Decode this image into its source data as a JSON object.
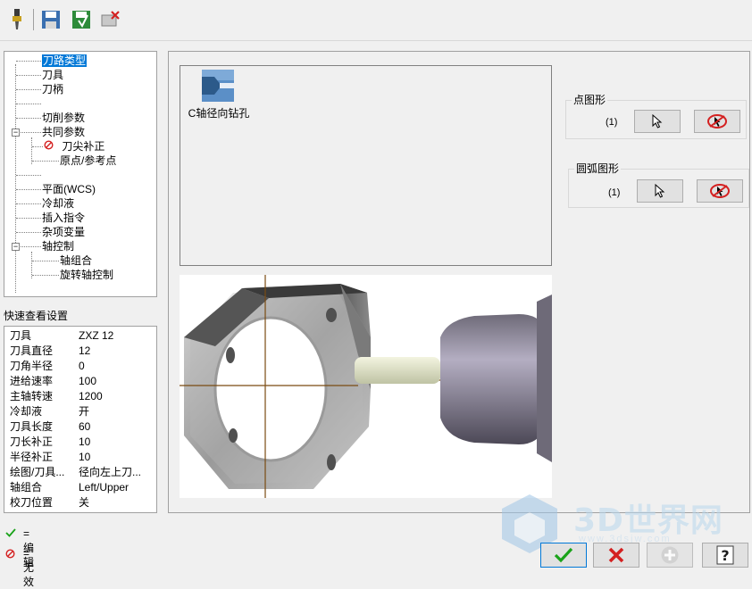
{
  "tree": {
    "items": [
      {
        "label": "刀路类型",
        "selected": true
      },
      {
        "label": "刀具"
      },
      {
        "label": "刀柄"
      },
      {
        "label": ""
      },
      {
        "label": "切削参数"
      },
      {
        "label": "共同参数"
      },
      {
        "label": "刀尖补正",
        "disabled": true
      },
      {
        "label": "原点/参考点"
      },
      {
        "label": ""
      },
      {
        "label": "平面(WCS)"
      },
      {
        "label": "冷却液"
      },
      {
        "label": "插入指令"
      },
      {
        "label": "杂项变量"
      },
      {
        "label": "轴控制"
      },
      {
        "label": "轴组合"
      },
      {
        "label": "旋转轴控制"
      }
    ]
  },
  "quick_view": {
    "title": "快速查看设置",
    "rows": [
      {
        "k": "刀具",
        "v": "ZXZ 12"
      },
      {
        "k": "刀具直径",
        "v": "12"
      },
      {
        "k": "刀角半径",
        "v": "0"
      },
      {
        "k": "进给速率",
        "v": "100"
      },
      {
        "k": "主轴转速",
        "v": "1200"
      },
      {
        "k": "冷却液",
        "v": "开"
      },
      {
        "k": "刀具长度",
        "v": "60"
      },
      {
        "k": "刀长补正",
        "v": "10"
      },
      {
        "k": "半径补正",
        "v": "10"
      },
      {
        "k": "绘图/刀具...",
        "v": "径向左上刀..."
      },
      {
        "k": "轴组合",
        "v": "Left/Upper"
      },
      {
        "k": "校刀位置",
        "v": "关"
      }
    ]
  },
  "legend": {
    "edit": "=编辑",
    "invalid": "=无效"
  },
  "operation": {
    "label": "C轴径向钻孔"
  },
  "point_group": {
    "title": "点图形",
    "count": "(1)"
  },
  "arc_group": {
    "title": "圆弧图形",
    "count": "(1)"
  },
  "watermark": {
    "text": "3D世界网",
    "url": "www.3dsjw.com"
  },
  "colors": {
    "accent": "#0078d7",
    "ok_green": "#1aa31a",
    "cancel_red": "#d42020"
  }
}
